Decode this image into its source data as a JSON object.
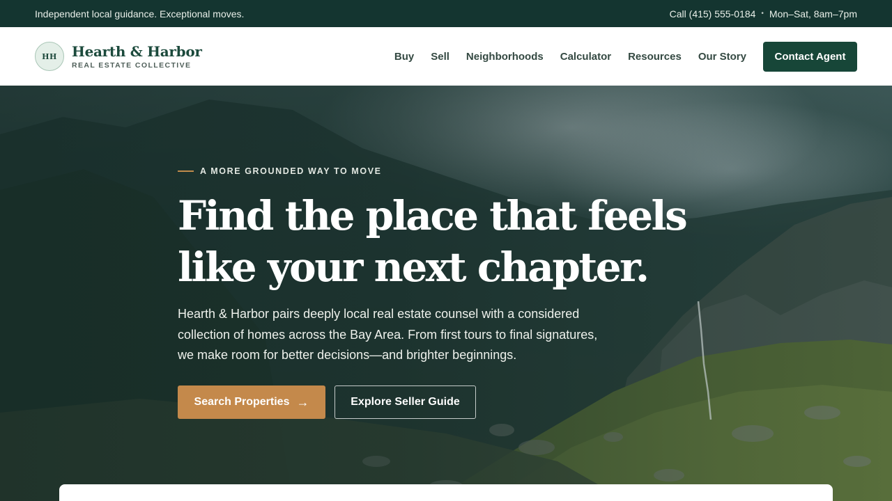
{
  "topbar": {
    "tagline": "Independent local guidance. Exceptional moves.",
    "phone": "Call (415) 555-0184",
    "separator": "•",
    "hours": "Mon–Sat, 8am–7pm"
  },
  "brand": {
    "monogram": "HH",
    "name": "Hearth & Harbor",
    "tagline": "REAL ESTATE COLLECTIVE"
  },
  "nav": {
    "items": [
      "Buy",
      "Sell",
      "Neighborhoods",
      "Calculator",
      "Resources",
      "Our Story"
    ],
    "cta": "Contact Agent"
  },
  "hero": {
    "eyebrow": "A MORE GROUNDED WAY TO MOVE",
    "headline": "Find the place that feels like your next chapter.",
    "subtext": "Hearth & Harbor pairs deeply local real estate counsel with a considered collection of homes across the Bay Area. From first tours to final signatures, we make room for better decisions—and brighter beginnings.",
    "primary_button": "Search Properties",
    "primary_button_icon": "arrow-right-icon",
    "arrow_glyph": "→",
    "secondary_button": "Explore Seller Guide"
  },
  "colors": {
    "topbar_bg": "#143530",
    "brand_green": "#174638",
    "accent_gold": "#c4894b",
    "white": "#ffffff"
  }
}
